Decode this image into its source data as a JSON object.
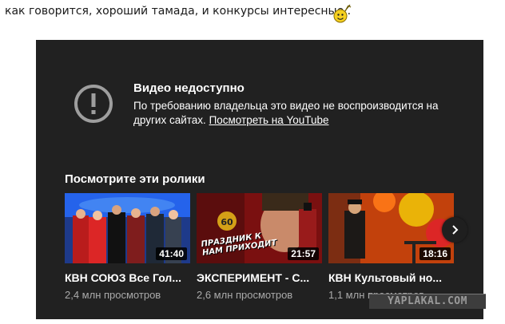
{
  "comment": {
    "text": "как говорится, хороший тамада, и конкурсы интересные..",
    "emoticon": "dancing-smiley-icon"
  },
  "player": {
    "error_title": "Видео недоступно",
    "error_message": "По требованию владельца это видео не воспроизводится на других сайтах.",
    "watch_link": "Посмотреть на YouTube",
    "suggestions_title": "Посмотрите эти ролики",
    "videos": [
      {
        "title": "КВН СОЮЗ Все Гол...",
        "views": "2,4 млн просмотров",
        "duration": "41:40"
      },
      {
        "title": "ЭКСПЕРИМЕНТ - С...",
        "views": "2,6 млн просмотров",
        "duration": "21:57",
        "thumb_text": "ПРАЗДНИК К НАМ ПРИХОДИТ",
        "thumb_badge": "60"
      },
      {
        "title": "КВН Культовый но...",
        "views": "1,1 млн просмотров",
        "duration": "18:16"
      }
    ],
    "next_icon": "chevron-right-icon"
  },
  "watermark": "YAPLAKAL.COM",
  "colors": {
    "player_bg": "#212121",
    "muted_text": "#aaaaaa"
  }
}
